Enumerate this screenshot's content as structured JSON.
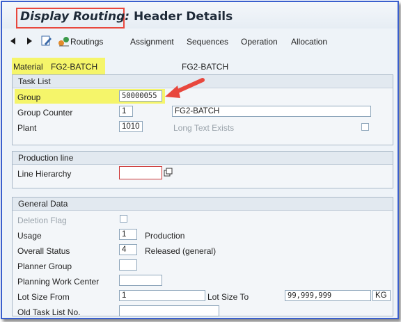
{
  "window": {
    "title_part1": "Display Routing:",
    "title_part2": " Header Details"
  },
  "toolbar": {
    "back_icon": "arrow-left-icon",
    "forward_icon": "arrow-right-icon",
    "edit_icon": "pencil-icon",
    "routings_icon": "routings-icon",
    "routings_label": "Routings",
    "assignment_label": "Assignment",
    "sequences_label": "Sequences",
    "operation_label": "Operation",
    "allocation_label": "Allocation"
  },
  "material": {
    "label": "Material",
    "value": "FG2-BATCH",
    "description": "FG2-BATCH"
  },
  "task_list": {
    "title": "Task List",
    "group_label": "Group",
    "group_value": "50000055",
    "group_counter_label": "Group Counter",
    "group_counter_value": "1",
    "group_counter_description": "FG2-BATCH",
    "plant_label": "Plant",
    "plant_value": "1010",
    "long_text_label": "Long Text Exists"
  },
  "production_line": {
    "title": "Production line",
    "line_hierarchy_label": "Line Hierarchy",
    "line_hierarchy_value": ""
  },
  "general_data": {
    "title": "General Data",
    "deletion_flag_label": "Deletion Flag",
    "usage_label": "Usage",
    "usage_value": "1",
    "usage_text": "Production",
    "overall_status_label": "Overall Status",
    "overall_status_value": "4",
    "overall_status_text": "Released (general)",
    "planner_group_label": "Planner Group",
    "planner_group_value": "",
    "planning_work_center_label": "Planning Work Center",
    "planning_work_center_value": "",
    "lot_size_from_label": "Lot Size From",
    "lot_size_from_value": "1",
    "lot_size_to_label": "Lot Size To",
    "lot_size_to_value": "99,999,999",
    "lot_size_unit": "KG",
    "old_task_list_label": "Old Task List No.",
    "old_task_list_value": ""
  },
  "colors": {
    "highlight": "#f5f56a",
    "annotation": "#e8473d",
    "frame": "#3a5fcd"
  }
}
